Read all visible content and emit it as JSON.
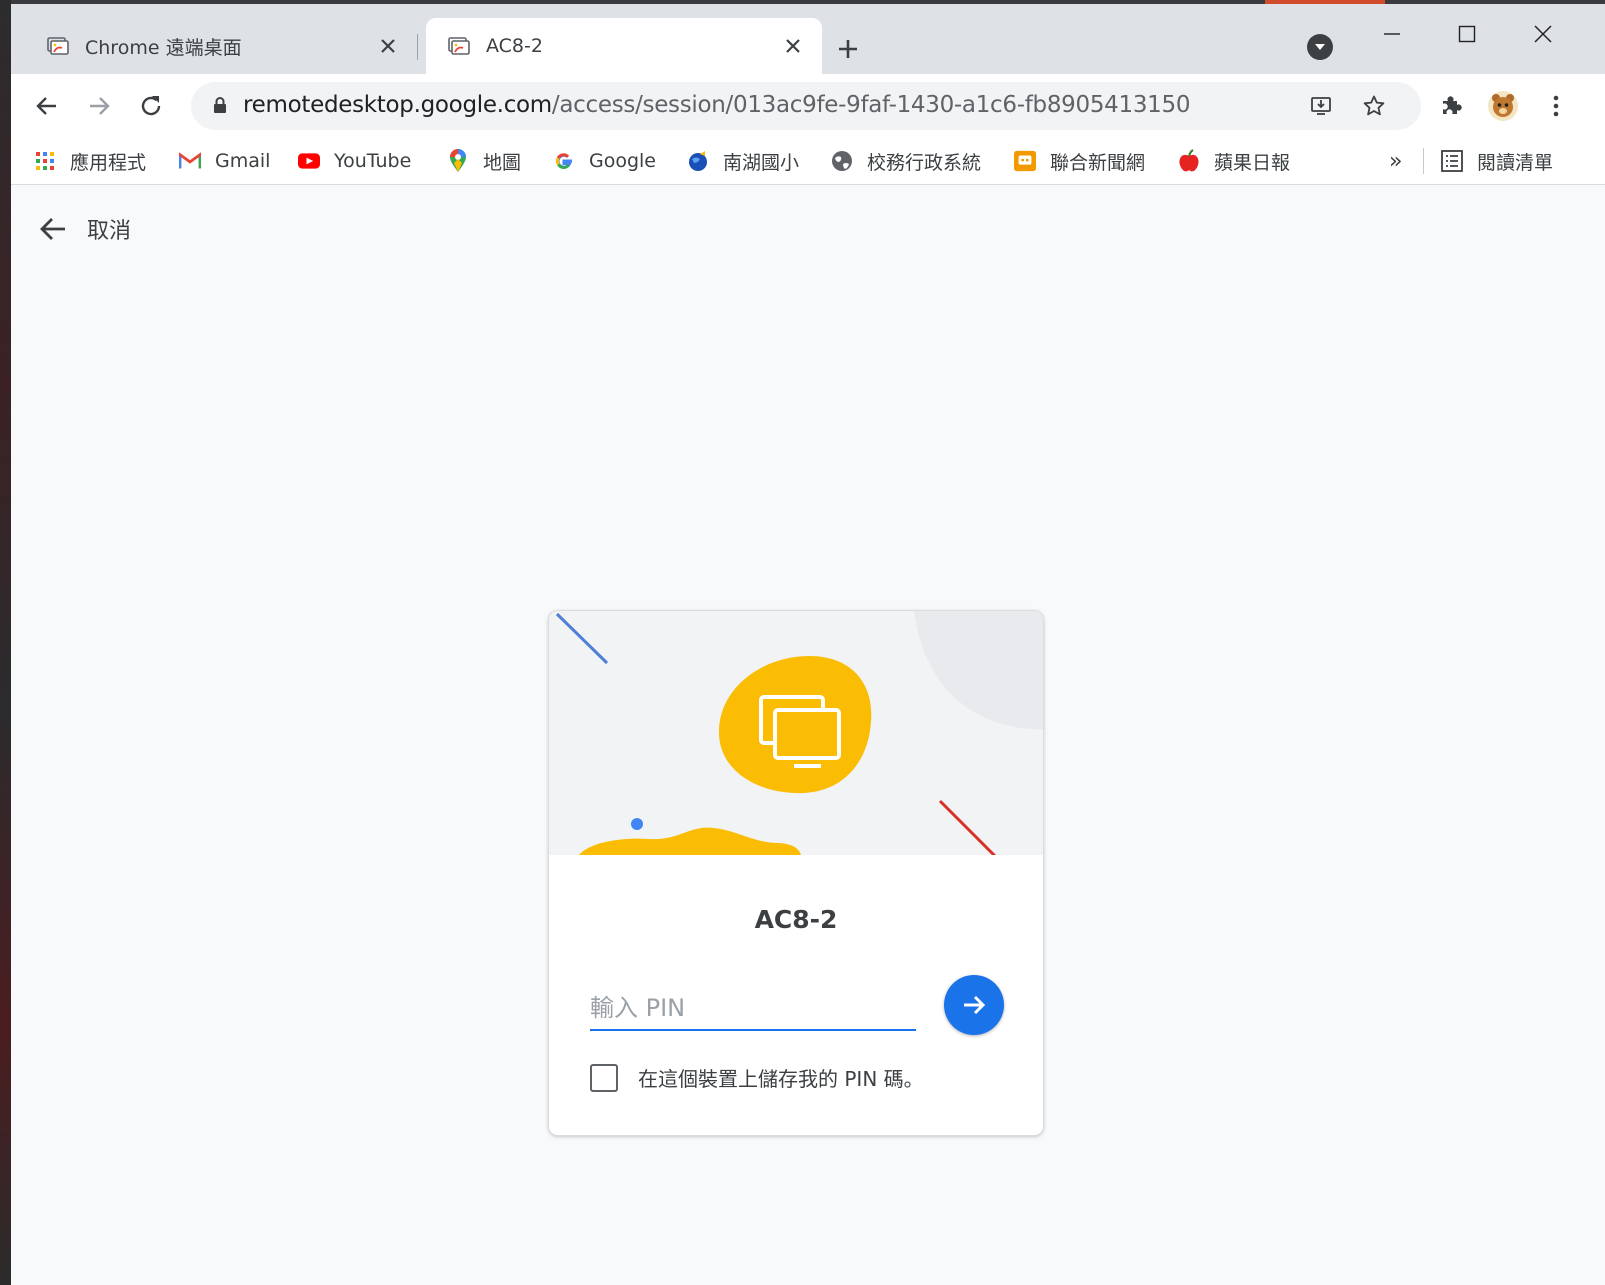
{
  "browser": {
    "tabs": [
      {
        "title": "Chrome 遠端桌面",
        "active": false,
        "icon": "remote-desktop-favicon"
      },
      {
        "title": "AC8-2",
        "active": true,
        "icon": "remote-desktop-favicon"
      }
    ],
    "new_tab_label": "+",
    "address": {
      "host": "remotedesktop.google.com",
      "path": "/access/session/013ac9fe-9faf-1430-a1c6-fb8905413150"
    },
    "bookmarks": [
      {
        "label": "應用程式",
        "icon": "apps-grid-icon"
      },
      {
        "label": "Gmail",
        "icon": "gmail-icon"
      },
      {
        "label": "YouTube",
        "icon": "youtube-icon"
      },
      {
        "label": "地圖",
        "icon": "maps-pin-icon"
      },
      {
        "label": "Google",
        "icon": "google-g-icon"
      },
      {
        "label": "南湖國小",
        "icon": "globe-blue-icon"
      },
      {
        "label": "校務行政系統",
        "icon": "globe-icon"
      },
      {
        "label": "聯合新聞網",
        "icon": "news-icon"
      },
      {
        "label": "蘋果日報",
        "icon": "apple-daily-icon"
      }
    ],
    "overflow_label": "»",
    "reading_list_label": "閱讀清單"
  },
  "page": {
    "cancel_label": "取消",
    "host_name": "AC8-2",
    "pin_placeholder": "輸入 PIN",
    "pin_value": "",
    "remember_pin_label": "在這個裝置上儲存我的 PIN 碼。",
    "remember_checked": false
  },
  "colors": {
    "accent_blue": "#1a73e8",
    "hero_yellow": "#fbbc04",
    "hero_red": "#d93025",
    "hero_blue": "#4285f4",
    "page_bg": "#f8f9fa"
  }
}
